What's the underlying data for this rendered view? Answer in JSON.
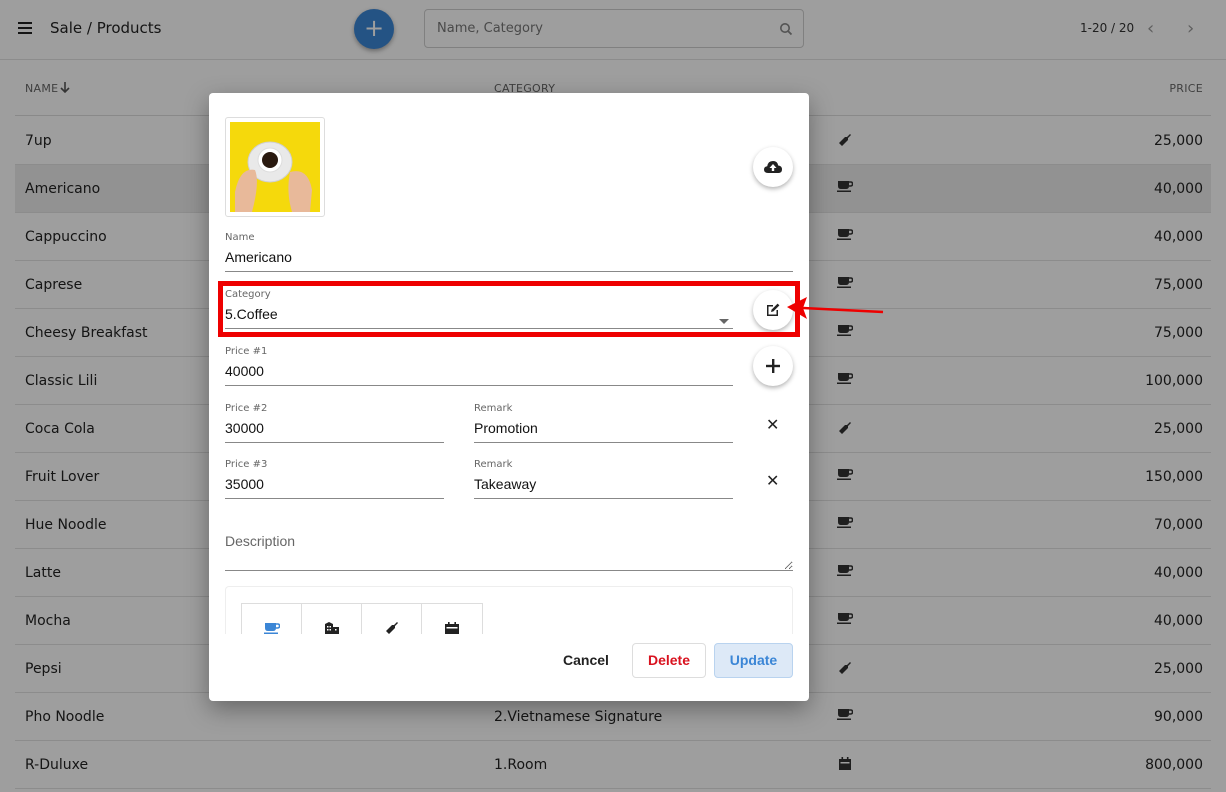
{
  "header": {
    "breadcrumb": "Sale / Products",
    "add_label": "+",
    "search_placeholder": "Name, Category",
    "pager_text": "1-20 / 20",
    "prev_label": "‹",
    "next_label": "›"
  },
  "table": {
    "columns": {
      "name": "NAME",
      "category": "CATEGORY",
      "price": "PRICE"
    },
    "rows": [
      {
        "name": "7up",
        "category": "",
        "icon": "drink-bottle-icon",
        "price": "25,000"
      },
      {
        "name": "Americano",
        "category": "",
        "icon": "coffee-cup-icon",
        "price": "40,000",
        "selected": true
      },
      {
        "name": "Cappuccino",
        "category": "",
        "icon": "coffee-cup-icon",
        "price": "40,000"
      },
      {
        "name": "Caprese",
        "category": "",
        "icon": "coffee-cup-icon",
        "price": "75,000"
      },
      {
        "name": "Cheesy Breakfast",
        "category": "",
        "icon": "coffee-cup-icon",
        "price": "75,000"
      },
      {
        "name": "Classic Lili",
        "category": "",
        "icon": "coffee-cup-icon",
        "price": "100,000"
      },
      {
        "name": "Coca Cola",
        "category": "",
        "icon": "drink-bottle-icon",
        "price": "25,000"
      },
      {
        "name": "Fruit Lover",
        "category": "",
        "icon": "coffee-cup-icon",
        "price": "150,000"
      },
      {
        "name": "Hue Noodle",
        "category": "",
        "icon": "coffee-cup-icon",
        "price": "70,000"
      },
      {
        "name": "Latte",
        "category": "",
        "icon": "coffee-cup-icon",
        "price": "40,000"
      },
      {
        "name": "Mocha",
        "category": "",
        "icon": "coffee-cup-icon",
        "price": "40,000"
      },
      {
        "name": "Pepsi",
        "category": "",
        "icon": "drink-bottle-icon",
        "price": "25,000"
      },
      {
        "name": "Pho Noodle",
        "category": "2.Vietnamese Signature",
        "icon": "coffee-cup-icon",
        "price": "90,000"
      },
      {
        "name": "R-Duluxe",
        "category": "1.Room",
        "icon": "calendar-icon",
        "price": "800,000"
      }
    ]
  },
  "dialog": {
    "name_label": "Name",
    "name_value": "Americano",
    "category_label": "Category",
    "category_value": "5.Coffee",
    "price1_label": "Price #1",
    "price1_value": "40000",
    "price2_label": "Price #2",
    "price2_value": "30000",
    "remark2_label": "Remark",
    "remark2_value": "Promotion",
    "price3_label": "Price #3",
    "price3_value": "35000",
    "remark3_label": "Remark",
    "remark3_value": "Takeaway",
    "description_placeholder": "Description",
    "icon_choices": [
      "coffee-cup-icon",
      "building-icon",
      "drink-bottle-icon",
      "calendar-icon"
    ],
    "selected_icon": "coffee-cup-icon",
    "remove_label": "✕",
    "cancel_label": "Cancel",
    "delete_label": "Delete",
    "update_label": "Update"
  },
  "colors": {
    "accent": "#3b86d6",
    "danger": "#d9121f",
    "annotation": "#ee0000",
    "thumbnail_bg": "#f5d90c"
  }
}
